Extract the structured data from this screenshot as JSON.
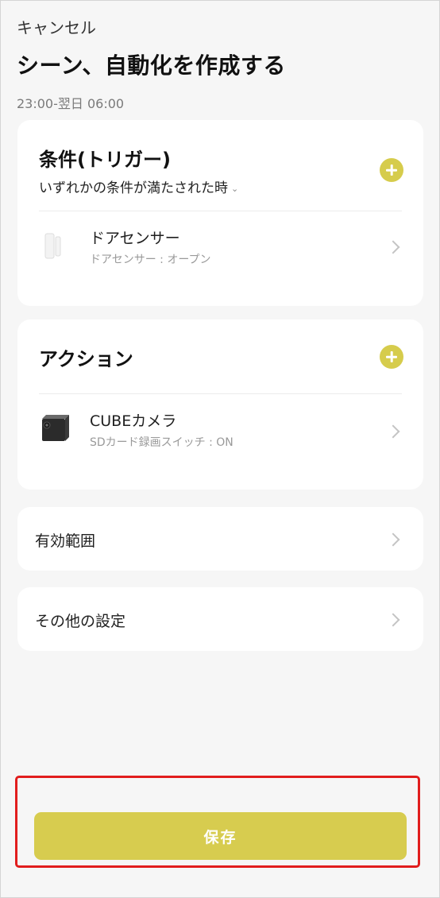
{
  "header": {
    "cancel_label": "キャンセル",
    "title": "シーン、自動化を作成する",
    "time_range": "23:00-翌日 06:00"
  },
  "trigger_card": {
    "heading": "条件(トリガー)",
    "condition_mode": "いずれかの条件が満たされた時",
    "add_icon": "plus-circle-icon",
    "device": {
      "name": "ドアセンサー",
      "status": "ドアセンサー : オープン",
      "icon": "door-sensor-icon"
    }
  },
  "action_card": {
    "heading": "アクション",
    "add_icon": "plus-circle-icon",
    "device": {
      "name": "CUBEカメラ",
      "status": "SDカード録画スイッチ : ON",
      "icon": "camera-icon"
    }
  },
  "scope_row": {
    "label": "有効範囲"
  },
  "other_settings_row": {
    "label": "その他の設定"
  },
  "footer": {
    "save_label": "保存"
  },
  "colors": {
    "accent": "#d7cc4f",
    "background": "#f6f6f6",
    "card": "#ffffff",
    "highlight": "#e11d1d"
  }
}
